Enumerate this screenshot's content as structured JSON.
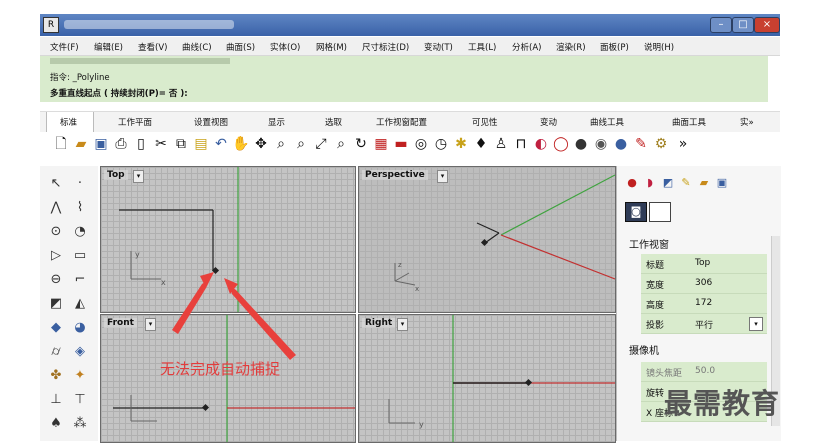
{
  "window": {
    "app_icon": "R"
  },
  "menu": [
    "文件(F)",
    "编辑(E)",
    "查看(V)",
    "曲线(C)",
    "曲面(S)",
    "实体(O)",
    "网格(M)",
    "尺寸标注(D)",
    "变动(T)",
    "工具(L)",
    "分析(A)",
    "渲染(R)",
    "面板(P)",
    "说明(H)"
  ],
  "command": {
    "line1": "指令: _Polyline",
    "line2": "多重直线起点 ( 持续封闭(P)= 否 ):"
  },
  "tabs": [
    "标准",
    "工作平面",
    "设置视图",
    "显示",
    "选取",
    "工作视窗配置",
    "可见性",
    "变动",
    "曲线工具",
    "曲面工具",
    "实»"
  ],
  "viewports": {
    "top": {
      "title": "Top"
    },
    "perspective": {
      "title": "Perspective"
    },
    "front": {
      "title": "Front"
    },
    "right": {
      "title": "Right"
    }
  },
  "panel": {
    "section_viewport": "工作视窗",
    "props": [
      {
        "label": "标题",
        "value": "Top"
      },
      {
        "label": "宽度",
        "value": "306"
      },
      {
        "label": "高度",
        "value": "172"
      },
      {
        "label": "投影",
        "value": "平行"
      }
    ],
    "section_camera": "摄像机",
    "camera": [
      {
        "label": "镜头焦距",
        "value": "50.0"
      },
      {
        "label": "旋转",
        "value": ""
      },
      {
        "label": "X 座标",
        "value": ""
      }
    ]
  },
  "annotation": "无法完成自动捕捉",
  "watermark": "最需教育",
  "colors": {
    "command_bg": "#d9ebcd",
    "axis_green": "#3fa33f",
    "axis_red": "#c23030",
    "annotation": "#e23c3c"
  }
}
